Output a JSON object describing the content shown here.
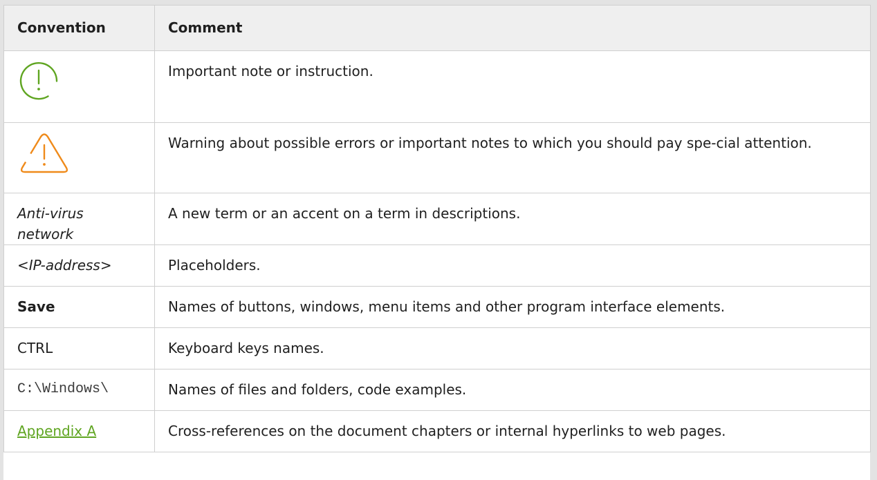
{
  "table": {
    "headers": {
      "convention": "Convention",
      "comment": "Comment"
    },
    "rows": [
      {
        "convention_icon": "important-icon",
        "comment": "Important note or instruction."
      },
      {
        "convention_icon": "warning-icon",
        "comment": "Warning about possible errors or important notes to which you should pay spe-cial attention."
      },
      {
        "convention": "Anti-virus network",
        "comment": "A new term or an accent on a term in descriptions."
      },
      {
        "convention": "<IP-address>",
        "comment": "Placeholders."
      },
      {
        "convention": "Save",
        "comment": "Names of buttons, windows, menu items and other program interface elements."
      },
      {
        "convention": "CTRL",
        "comment": "Keyboard keys names."
      },
      {
        "convention": "C:\\Windows\\",
        "comment": "Names of files and folders, code examples."
      },
      {
        "convention": "Appendix A",
        "comment": "Cross-references on the document chapters or internal hyperlinks to web pages."
      }
    ]
  },
  "colors": {
    "important_icon": "#5fa521",
    "warning_icon": "#ef8a1a",
    "link": "#5fa521",
    "header_bg": "#efefef",
    "frame": "#e3e3e3",
    "border": "#cfcfcf"
  }
}
